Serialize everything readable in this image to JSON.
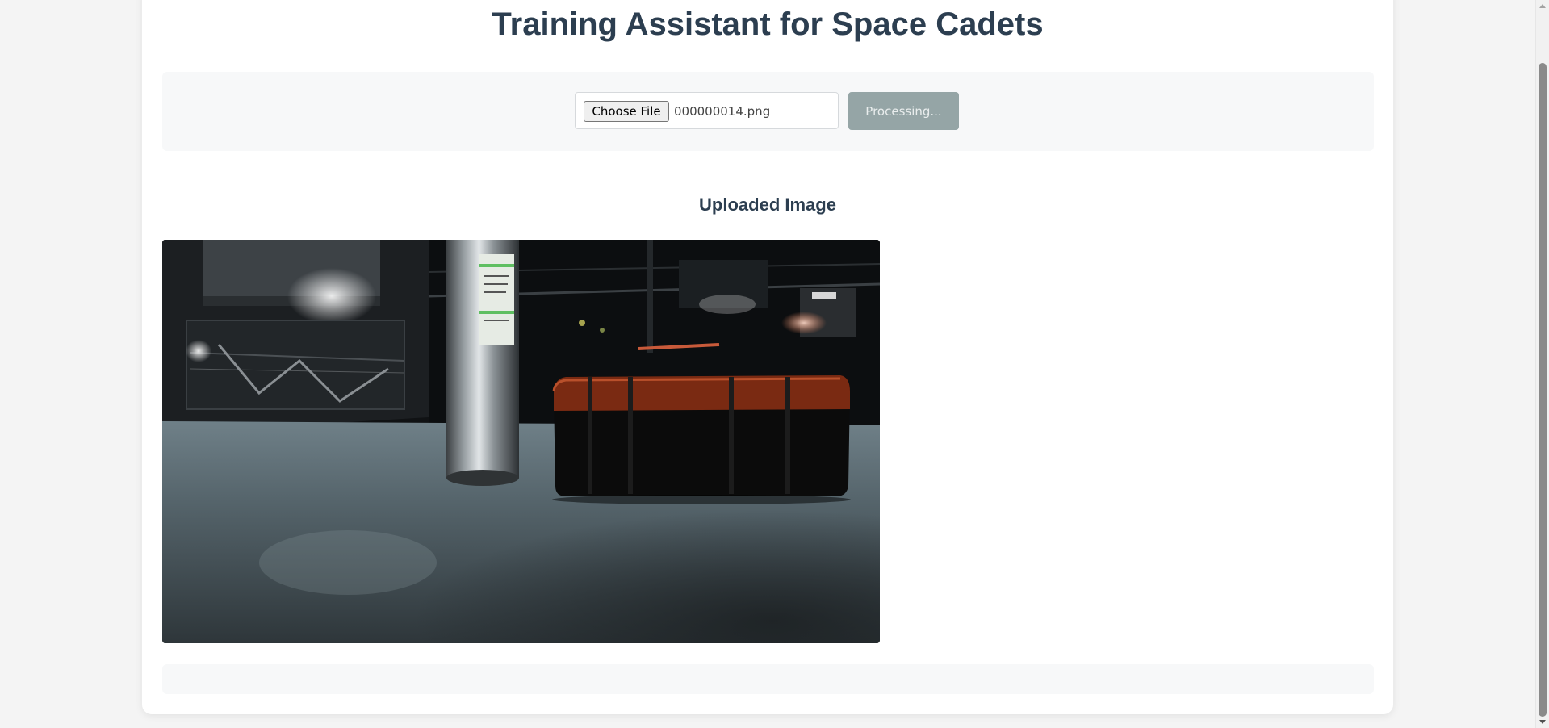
{
  "header": {
    "title": "Training Assistant for Space Cadets"
  },
  "upload": {
    "choose_file_label": "Choose File",
    "selected_file": "000000014.png",
    "process_button_label": "Processing..."
  },
  "preview": {
    "section_title": "Uploaded Image",
    "image_alt": "Uploaded image: metal cylinder and dark orange-trimmed case on a spaceship floor"
  },
  "colors": {
    "title": "#2c3e50",
    "process_button_bg": "#95a5a6",
    "panel_bg": "#f7f8f9",
    "page_bg": "#f4f4f4"
  }
}
